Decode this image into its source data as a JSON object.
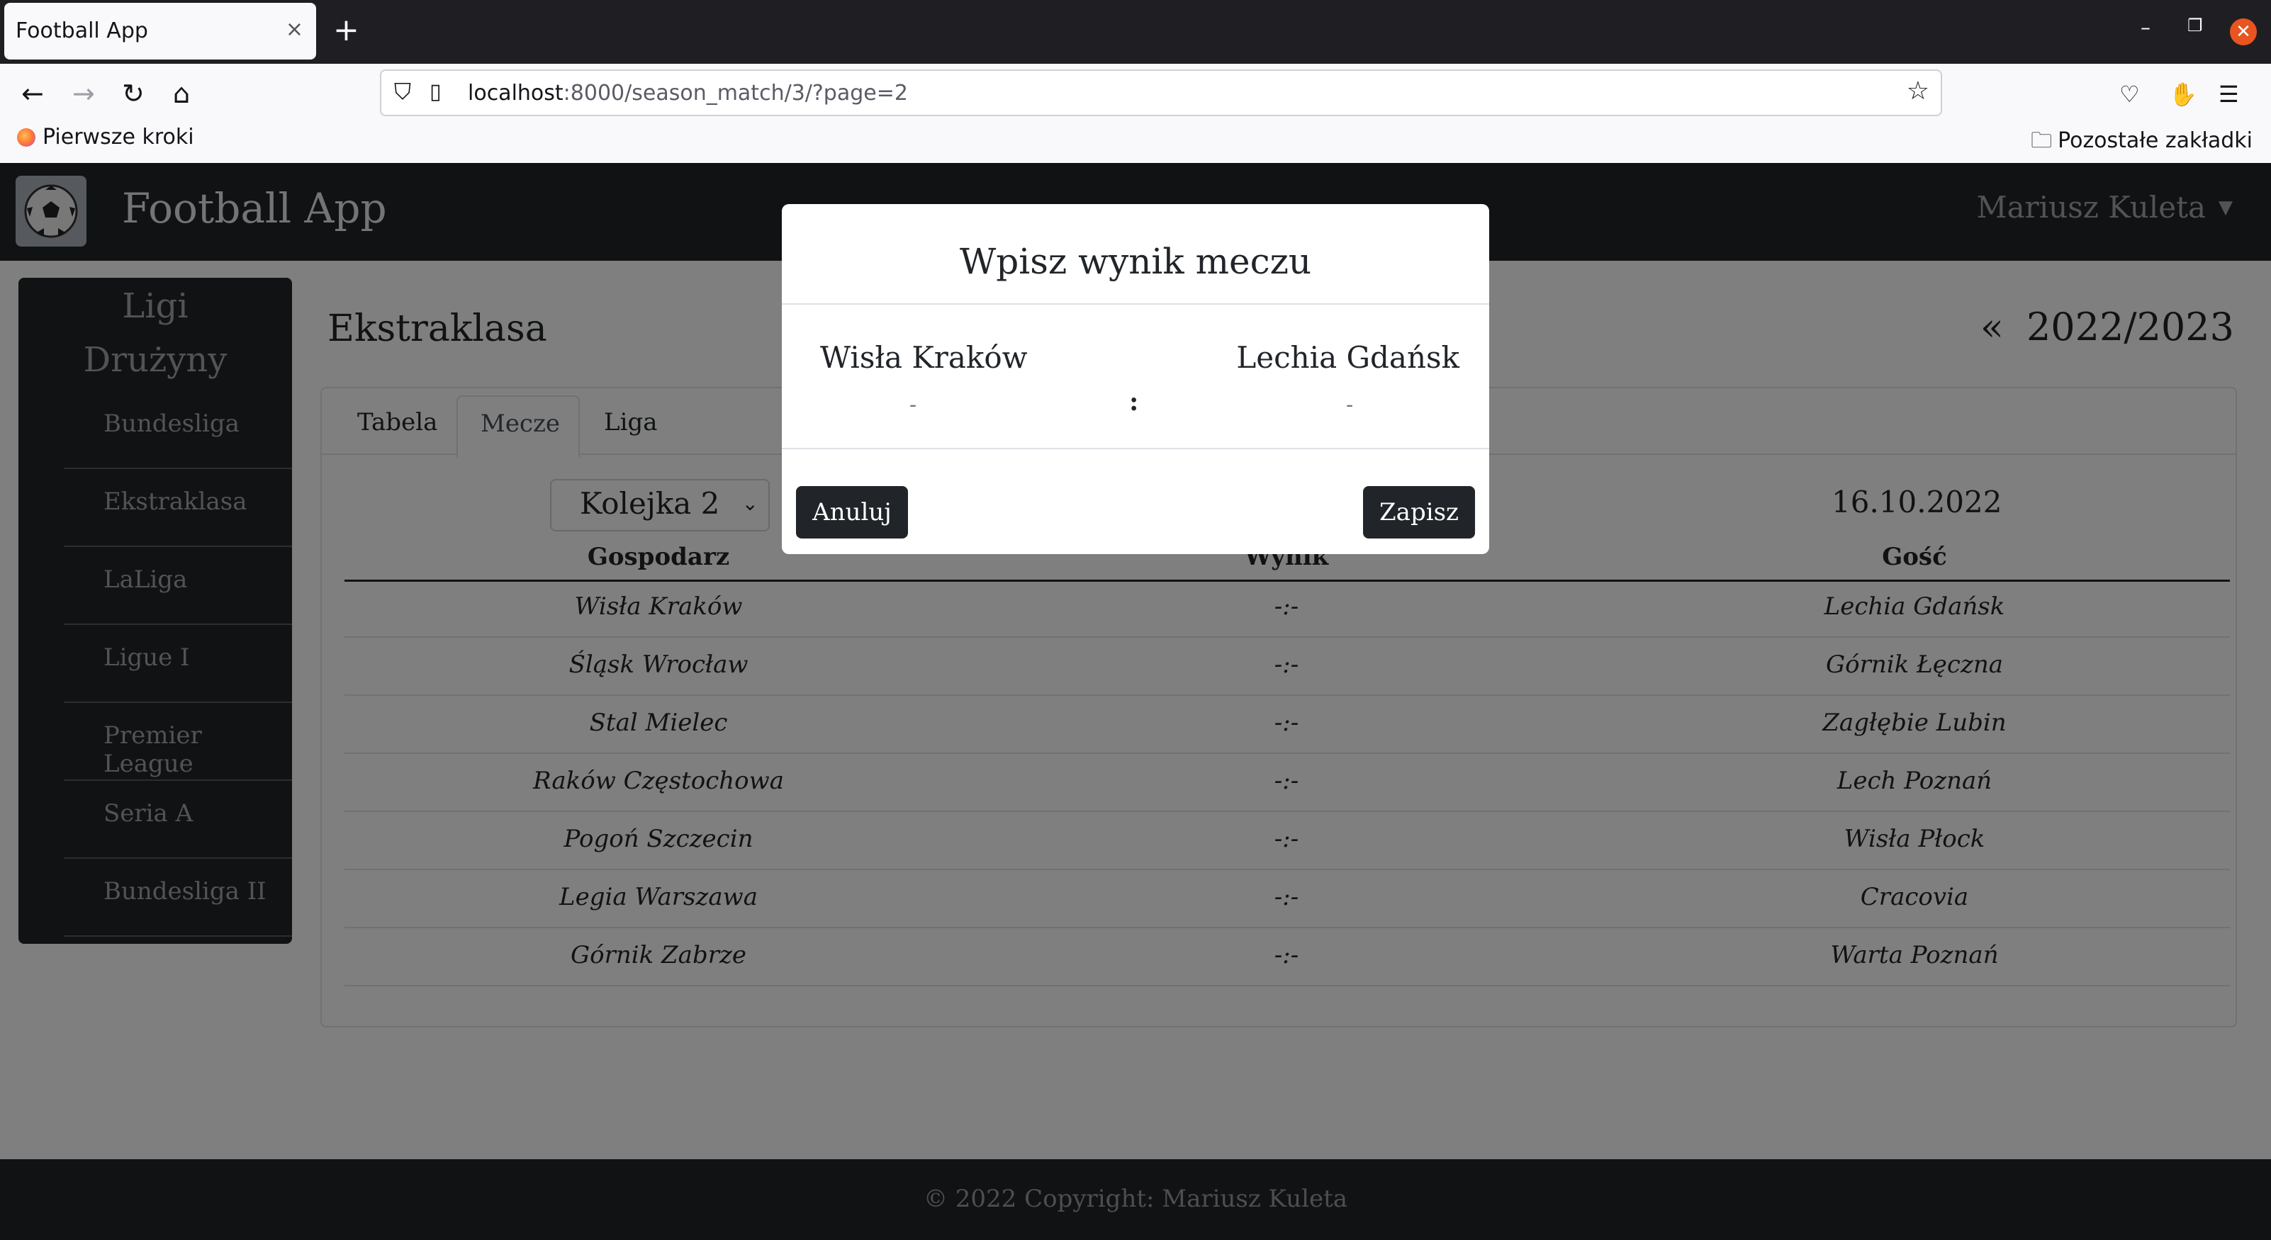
{
  "browser": {
    "tab_title": "Football App",
    "tab_close": "×",
    "new_tab": "+",
    "url_host": "localhost",
    "url_path": ":8000/season_match/3/?page=2",
    "bookmark_first": "Pierwsze kroki",
    "bookmark_other": "Pozostałe zakładki"
  },
  "app": {
    "brand": "Football App",
    "user": "Mariusz Kuleta"
  },
  "sidebar": {
    "heading_leagues": "Ligi",
    "heading_teams": "Drużyny",
    "items": [
      {
        "label": "Bundesliga"
      },
      {
        "label": "Ekstraklasa"
      },
      {
        "label": "LaLiga"
      },
      {
        "label": "Ligue I"
      },
      {
        "label": "Premier League"
      },
      {
        "label": "Seria A"
      },
      {
        "label": "Bundesliga II"
      }
    ]
  },
  "content": {
    "league": "Ekstraklasa",
    "season_prev": "«",
    "season": "2022/2023",
    "tabs": [
      {
        "label": "Tabela"
      },
      {
        "label": "Mecze"
      },
      {
        "label": "Liga"
      }
    ],
    "round_selected": "Kolejka 2",
    "date": "16.10.2022",
    "columns": {
      "home": "Gospodarz",
      "result": "Wynik",
      "away": "Gość"
    },
    "matches": [
      {
        "home": "Wisła Kraków",
        "result": "-:-",
        "away": "Lechia Gdańsk"
      },
      {
        "home": "Śląsk Wrocław",
        "result": "-:-",
        "away": "Górnik Łęczna"
      },
      {
        "home": "Stal Mielec",
        "result": "-:-",
        "away": "Zagłębie Lubin"
      },
      {
        "home": "Raków Częstochowa",
        "result": "-:-",
        "away": "Lech Poznań"
      },
      {
        "home": "Pogoń Szczecin",
        "result": "-:-",
        "away": "Wisła Płock"
      },
      {
        "home": "Legia Warszawa",
        "result": "-:-",
        "away": "Cracovia"
      },
      {
        "home": "Górnik Zabrze",
        "result": "-:-",
        "away": "Warta Poznań"
      }
    ]
  },
  "footer": {
    "text": "© 2022 Copyright: Mariusz Kuleta"
  },
  "modal": {
    "title": "Wpisz wynik meczu",
    "home_team": "Wisła Kraków",
    "away_team": "Lechia Gdańsk",
    "home_score": "-",
    "separator": ":",
    "away_score": "-",
    "cancel_label": "Anuluj",
    "save_label": "Zapisz"
  }
}
